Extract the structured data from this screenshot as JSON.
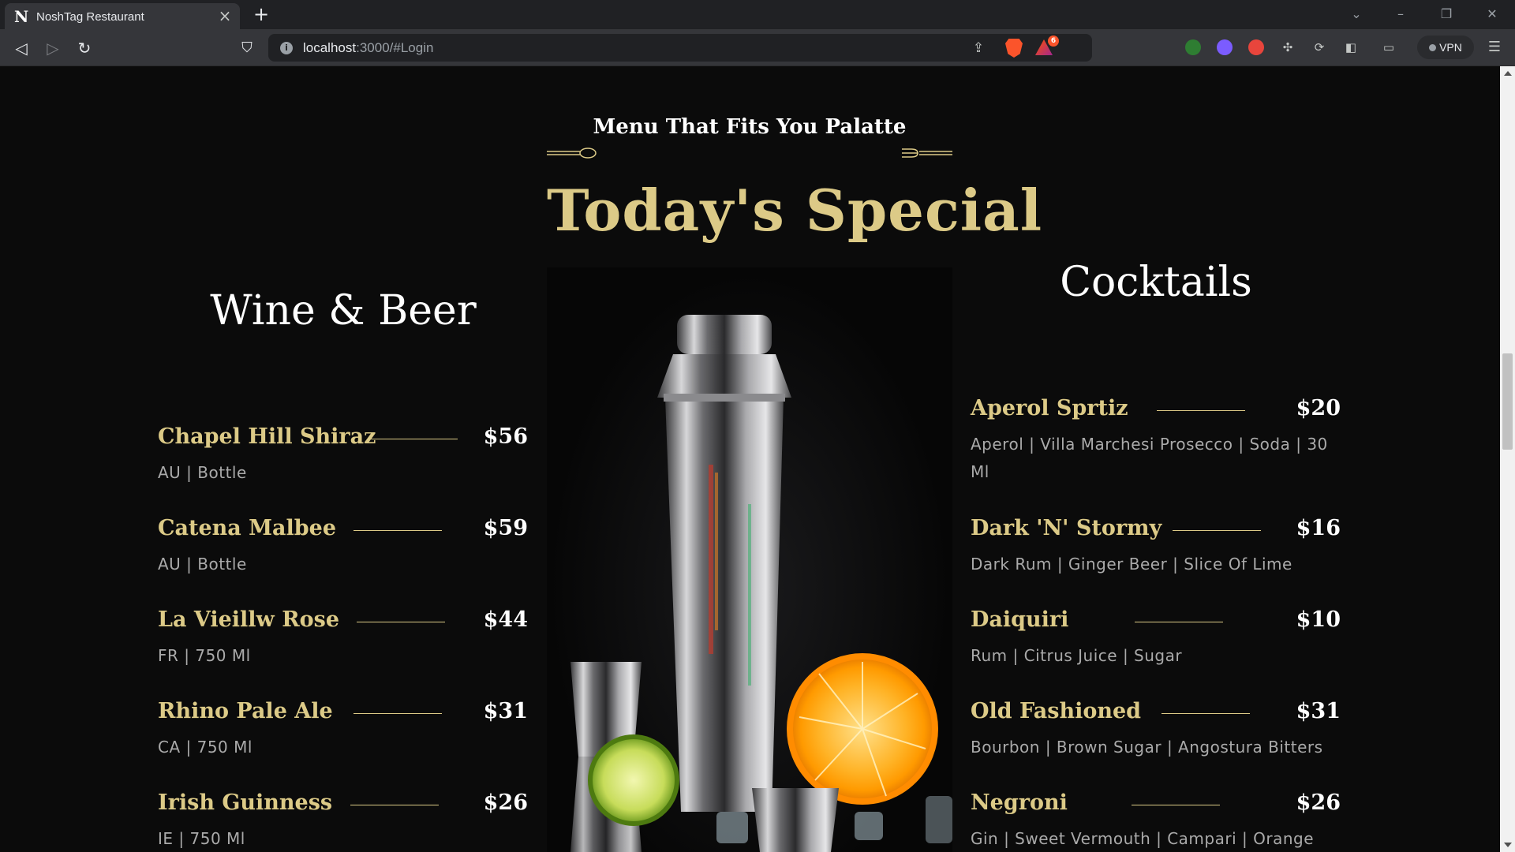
{
  "browser": {
    "tab_title": "NoshTag Restaurant",
    "tab_favicon": "N",
    "url_host": "localhost",
    "url_path": ":3000/#Login",
    "badge_count": "6",
    "vpn_label": "VPN"
  },
  "menu": {
    "subtitle": "Menu That Fits You Palatte",
    "title": "Today's Special",
    "wine_title": "Wine & Beer",
    "cocktails_title": "Cocktails",
    "wines": [
      {
        "name": "Chapel Hill Shiraz",
        "price": "$56",
        "desc": "AU | Bottle"
      },
      {
        "name": "Catena Malbee",
        "price": "$59",
        "desc": "AU | Bottle"
      },
      {
        "name": "La Vieillw Rose",
        "price": "$44",
        "desc": "FR | 750 Ml"
      },
      {
        "name": "Rhino Pale Ale",
        "price": "$31",
        "desc": "CA | 750 Ml"
      },
      {
        "name": "Irish Guinness",
        "price": "$26",
        "desc": "IE | 750 Ml"
      }
    ],
    "cocktails": [
      {
        "name": "Aperol Sprtiz",
        "price": "$20",
        "desc": "Aperol | Villa Marchesi Prosecco | Soda | 30 Ml"
      },
      {
        "name": "Dark 'N' Stormy",
        "price": "$16",
        "desc": "Dark Rum | Ginger Beer | Slice Of Lime"
      },
      {
        "name": "Daiquiri",
        "price": "$10",
        "desc": "Rum | Citrus Juice | Sugar"
      },
      {
        "name": "Old Fashioned",
        "price": "$31",
        "desc": "Bourbon | Brown Sugar | Angostura Bitters"
      },
      {
        "name": "Negroni",
        "price": "$26",
        "desc": "Gin | Sweet Vermouth | Campari | Orange"
      }
    ]
  },
  "colors": {
    "gold": "#dcca87",
    "background": "#0b0b0b",
    "text_muted": "#aaaaaa"
  }
}
